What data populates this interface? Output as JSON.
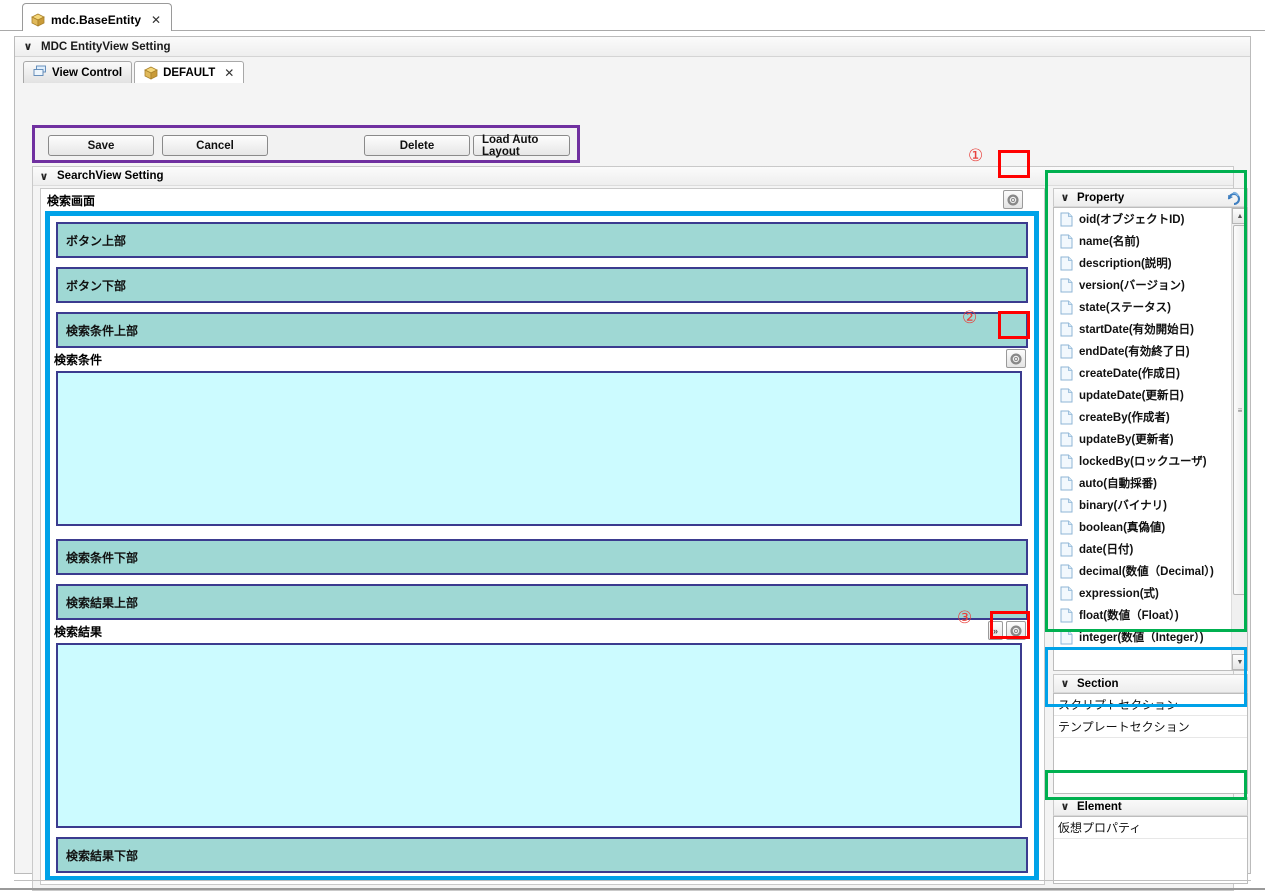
{
  "window": {
    "document_tab": {
      "label": "mdc.BaseEntity",
      "close": "✕",
      "icon": "cube-icon"
    }
  },
  "outer_panel": {
    "title": "MDC EntityView Setting",
    "collapse_icon": "chevron-down-icon"
  },
  "inner_tabs": [
    {
      "label": "View Control",
      "icon": "view-control-icon",
      "active": false,
      "closable": false
    },
    {
      "label": "DEFAULT",
      "icon": "cube-icon",
      "active": true,
      "closable": true,
      "close": "✕"
    }
  ],
  "toolbar": {
    "save_label": "Save",
    "cancel_label": "Cancel",
    "delete_label": "Delete",
    "load_auto_layout_label": "Load Auto Layout",
    "highlight_color": "#7030a0"
  },
  "searchview": {
    "title": "SearchView Setting",
    "collapse_icon": "chevron-down-icon",
    "canvas_title": "検索画面",
    "bars": [
      {
        "label": "ボタン上部"
      },
      {
        "label": "ボタン下部"
      },
      {
        "label": "検索条件上部"
      }
    ],
    "region_condition": {
      "label": "検索条件"
    },
    "bars_mid": [
      {
        "label": "検索条件下部"
      },
      {
        "label": "検索結果上部"
      }
    ],
    "region_result": {
      "label": "検索結果"
    },
    "bars_bottom": [
      {
        "label": "検索結果下部"
      }
    ],
    "markers": [
      {
        "id": "1",
        "glyph": "①"
      },
      {
        "id": "2",
        "glyph": "②"
      },
      {
        "id": "3",
        "glyph": "③"
      }
    ],
    "gear_icon": "gear-icon",
    "expand_icon": "chevron-double-right-icon",
    "marker_color": "#ff0000"
  },
  "property_panel": {
    "title": "Property",
    "collapse_icon": "chevron-down-icon",
    "refresh_icon": "refresh-icon",
    "highlight_color": "#00b050",
    "items": [
      {
        "label": "oid(オブジェクトID)"
      },
      {
        "label": "name(名前)"
      },
      {
        "label": "description(説明)"
      },
      {
        "label": "version(バージョン)"
      },
      {
        "label": "state(ステータス)"
      },
      {
        "label": "startDate(有効開始日)"
      },
      {
        "label": "endDate(有効終了日)"
      },
      {
        "label": "createDate(作成日)"
      },
      {
        "label": "updateDate(更新日)"
      },
      {
        "label": "createBy(作成者)"
      },
      {
        "label": "updateBy(更新者)"
      },
      {
        "label": "lockedBy(ロックユーザ)"
      },
      {
        "label": "auto(自動採番)"
      },
      {
        "label": "binary(バイナリ)"
      },
      {
        "label": "boolean(真偽値)"
      },
      {
        "label": "date(日付)"
      },
      {
        "label": "decimal(数値（Decimal）)"
      },
      {
        "label": "expression(式)"
      },
      {
        "label": "float(数値（Float）)"
      },
      {
        "label": "integer(数値（Integer）)"
      }
    ],
    "scrollbar": {
      "up": "▲",
      "down": "▼",
      "grip": "≡"
    }
  },
  "section_panel": {
    "title": "Section",
    "collapse_icon": "chevron-down-icon",
    "highlight_color": "#00a2e8",
    "items": [
      {
        "label": "スクリプトセクション"
      },
      {
        "label": "テンプレートセクション"
      }
    ]
  },
  "element_panel": {
    "title": "Element",
    "collapse_icon": "chevron-down-icon",
    "highlight_color": "#00b050",
    "items": [
      {
        "label": "仮想プロパティ"
      }
    ]
  }
}
